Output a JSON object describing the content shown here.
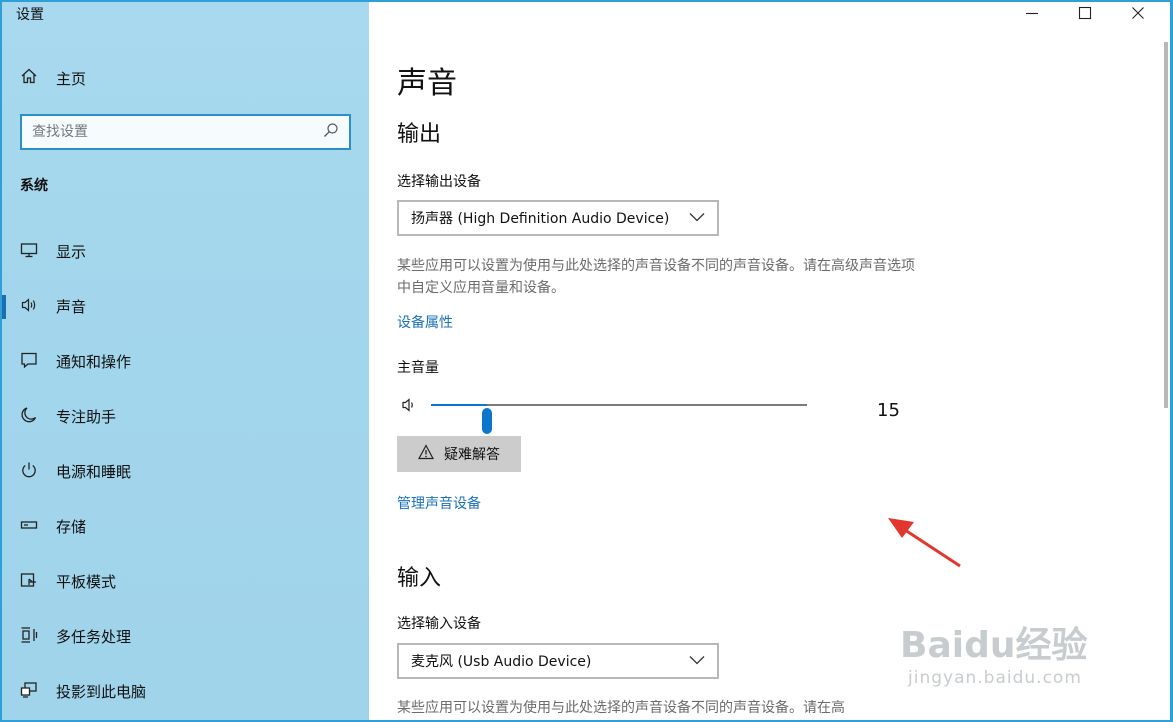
{
  "app": {
    "title": "设置"
  },
  "sidebar": {
    "home_label": "主页",
    "search_placeholder": "查找设置",
    "section": "系统",
    "items": [
      {
        "label": "显示",
        "icon": "monitor-icon"
      },
      {
        "label": "声音",
        "icon": "speaker-icon",
        "active": true
      },
      {
        "label": "通知和操作",
        "icon": "notification-icon"
      },
      {
        "label": "专注助手",
        "icon": "moon-icon"
      },
      {
        "label": "电源和睡眠",
        "icon": "power-icon"
      },
      {
        "label": "存储",
        "icon": "storage-icon"
      },
      {
        "label": "平板模式",
        "icon": "tablet-mode-icon"
      },
      {
        "label": "多任务处理",
        "icon": "multitasking-icon"
      },
      {
        "label": "投影到此电脑",
        "icon": "projecting-icon"
      }
    ]
  },
  "main": {
    "title": "声音",
    "output": {
      "heading": "输出",
      "device_label": "选择输出设备",
      "device_value": "扬声器 (High Definition Audio Device)",
      "description": "某些应用可以设置为使用与此处选择的声音设备不同的声音设备。请在高级声音选项中自定义应用音量和设备。",
      "properties_link": "设备属性",
      "volume_label": "主音量",
      "volume_value": "15",
      "volume_fraction": 0.15,
      "troubleshoot_label": "疑难解答",
      "manage_link": "管理声音设备"
    },
    "input": {
      "heading": "输入",
      "device_label": "选择输入设备",
      "device_value": "麦克风 (Usb Audio Device)",
      "description": "某些应用可以设置为使用与此处选择的声音设备不同的声音设备。请在高"
    }
  },
  "watermark": {
    "brand": "Baidu经验",
    "url": "jingyan.baidu.com"
  },
  "colors": {
    "accent": "#0a76cc",
    "link": "#1a72b9",
    "sidebar": "#a3d6ec",
    "annotation_arrow": "#e2372f"
  }
}
